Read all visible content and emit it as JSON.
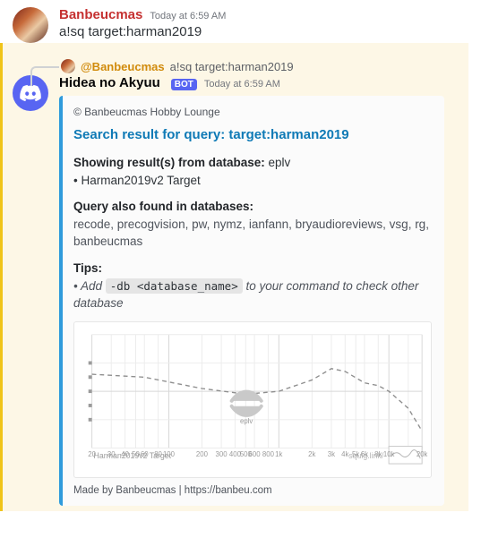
{
  "msg1": {
    "username": "Banbeucmas",
    "timestamp": "Today at 6:59 AM",
    "content": "a!sq target:harman2019"
  },
  "reply": {
    "mention": "@Banbeucmas",
    "snippet": "a!sq target:harman2019"
  },
  "msg2": {
    "username": "Hidea no Akyuu",
    "bot_tag": "BOT",
    "timestamp": "Today at 6:59 AM"
  },
  "embed": {
    "author": "© Banbeucmas Hobby Lounge",
    "title_prefix": "Search result for query: ",
    "title_query": "target:harman2019",
    "showing_label": "Showing result(s) from database:",
    "showing_db": " eplv",
    "result_item": "• Harman2019v2 Target",
    "also_label": "Query also found in databases:",
    "also_list": "recode, precogvision, pw, nymz, ianfann, bryaudioreviews, vsg, rg, banbeucmas",
    "tips_label": "Tips:",
    "tips_prefix": "• Add ",
    "tips_code": "-db <database_name>",
    "tips_suffix": " to your command to check other database",
    "footer": "Made by Banbeucmas | https://banbeu.com"
  },
  "chart_data": {
    "type": "line",
    "title": "",
    "xlabel": "",
    "ylabel": "",
    "series_label": "Harman2019v2 Target",
    "brand_label": "squig.link/",
    "watermark": "eplv",
    "x_ticks": [
      "20",
      "30",
      "40",
      "50",
      "60",
      "80",
      "100",
      "200",
      "300",
      "400",
      "500",
      "600",
      "800",
      "1k",
      "2k",
      "3k",
      "4k",
      "5k",
      "6k",
      "8k",
      "10k",
      "20k"
    ],
    "ylim_db": [
      -20,
      20
    ],
    "curve_db": [
      {
        "hz": 20,
        "db": 6
      },
      {
        "hz": 60,
        "db": 5
      },
      {
        "hz": 200,
        "db": 1
      },
      {
        "hz": 500,
        "db": -1
      },
      {
        "hz": 1000,
        "db": 0
      },
      {
        "hz": 2000,
        "db": 4
      },
      {
        "hz": 3000,
        "db": 8
      },
      {
        "hz": 4000,
        "db": 7
      },
      {
        "hz": 6000,
        "db": 3
      },
      {
        "hz": 8000,
        "db": 2
      },
      {
        "hz": 10000,
        "db": 0
      },
      {
        "hz": 15000,
        "db": -6
      },
      {
        "hz": 20000,
        "db": -14
      }
    ]
  }
}
